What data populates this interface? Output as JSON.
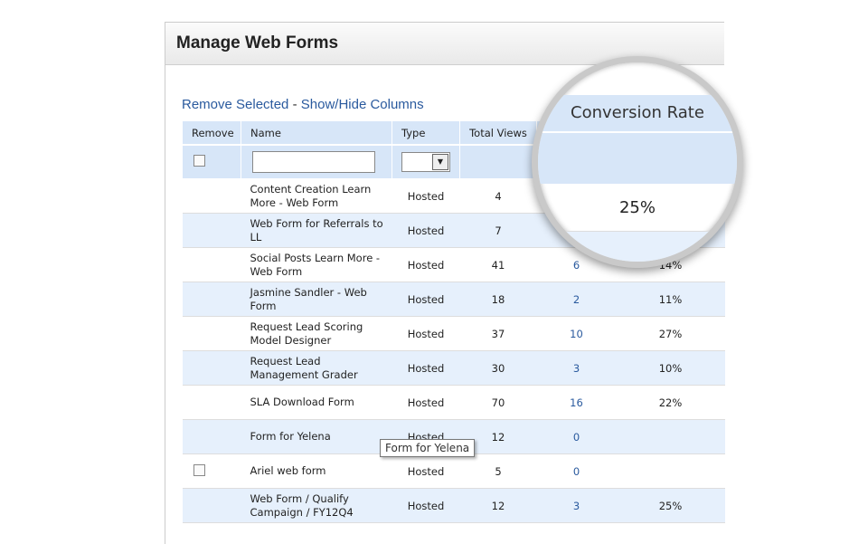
{
  "title": "Manage Web Forms",
  "actions": {
    "remove": "Remove Selected",
    "sep": " - ",
    "showhide": "Show/Hide Columns"
  },
  "columns": [
    "Remove",
    "Name",
    "Type",
    "Total Views",
    "",
    "Conversion Rate"
  ],
  "rows": [
    {
      "name": "Content Creation Learn More - Web Form",
      "type": "Hosted",
      "views": "4",
      "conv": "",
      "rate": ""
    },
    {
      "name": "Web Form for Referrals to LL",
      "type": "Hosted",
      "views": "7",
      "conv": "",
      "rate": ""
    },
    {
      "name": "Social Posts Learn More - Web Form",
      "type": "Hosted",
      "views": "41",
      "conv": "6",
      "rate": "14%"
    },
    {
      "name": "Jasmine Sandler - Web Form",
      "type": "Hosted",
      "views": "18",
      "conv": "2",
      "rate": "11%"
    },
    {
      "name": "Request Lead Scoring Model Designer",
      "type": "Hosted",
      "views": "37",
      "conv": "10",
      "rate": "27%"
    },
    {
      "name": "Request Lead Management Grader",
      "type": "Hosted",
      "views": "30",
      "conv": "3",
      "rate": "10%"
    },
    {
      "name": "SLA Download Form",
      "type": "Hosted",
      "views": "70",
      "conv": "16",
      "rate": "22%"
    },
    {
      "name": "Form for Yelena",
      "type": "Hosted",
      "views": "12",
      "conv": "0",
      "rate": ""
    },
    {
      "name": "Ariel web form",
      "type": "Hosted",
      "views": "5",
      "conv": "0",
      "rate": "",
      "checkbox": true
    },
    {
      "name": "Web Form / Qualify Campaign / FY12Q4",
      "type": "Hosted",
      "views": "12",
      "conv": "3",
      "rate": "25%"
    }
  ],
  "tooltip": "Form for Yelena",
  "magnifier": {
    "header": "Conversion Rate",
    "value": "25%"
  }
}
